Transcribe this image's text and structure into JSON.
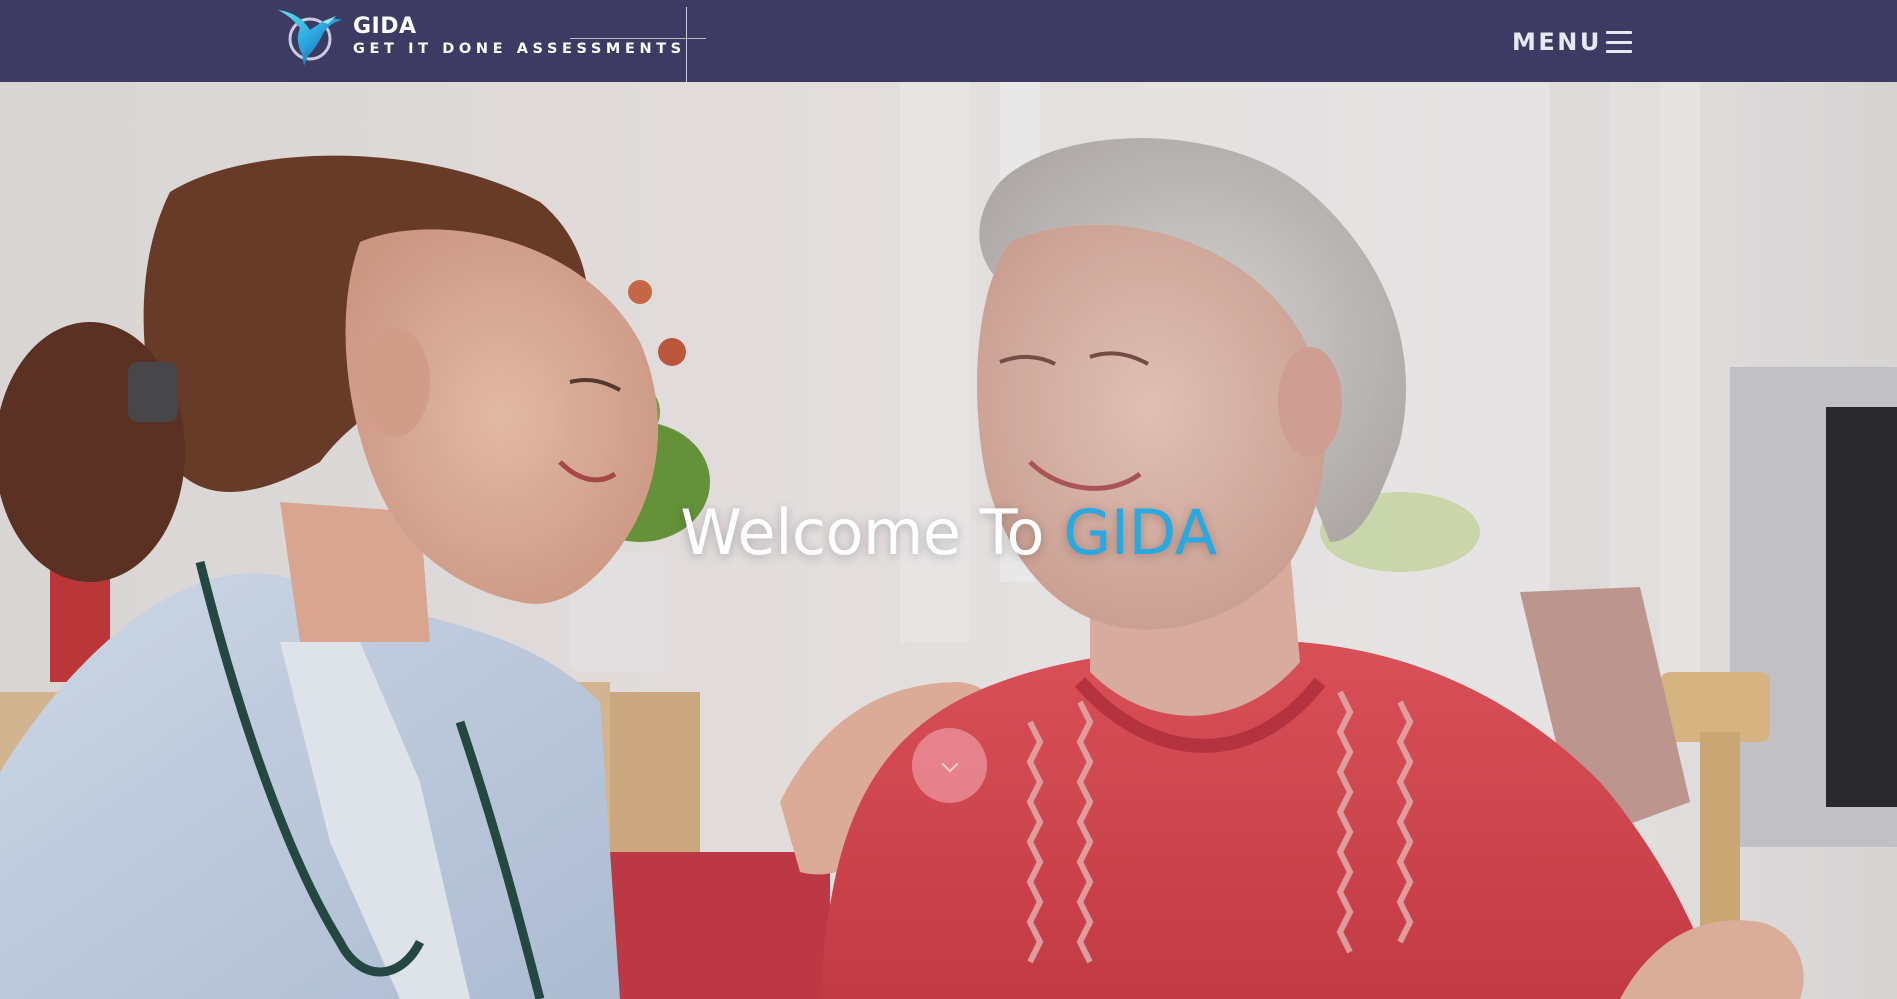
{
  "header": {
    "brand_name": "GIDA",
    "brand_tagline": "GET IT DONE ASSESSMENTS",
    "menu_label": "MENU"
  },
  "hero": {
    "title_prefix": "Welcome To ",
    "title_accent": "GIDA"
  },
  "colors": {
    "header_bg": "#3d3b63",
    "accent": "#2aa8e0",
    "text_light": "#ffffff"
  },
  "icons": {
    "logo": "hummingbird-logo-icon",
    "menu": "hamburger-menu-icon",
    "scroll": "scroll-down-icon"
  }
}
